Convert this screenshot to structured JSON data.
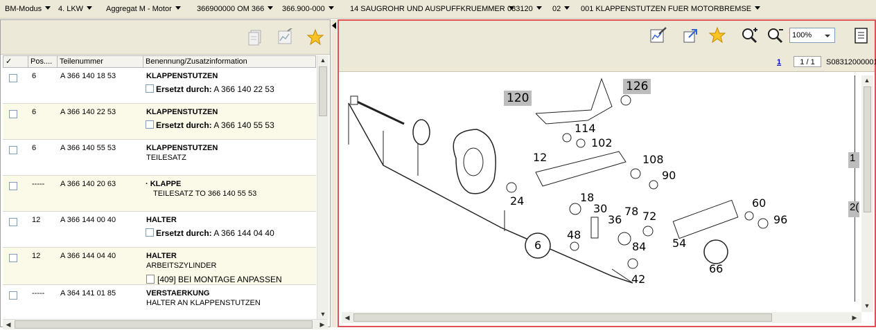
{
  "breadcrumbs": [
    {
      "label": "BM-Modus"
    },
    {
      "label": "4. LKW"
    },
    {
      "label": "Aggregat M  - Motor"
    },
    {
      "label": "366900000 OM 366"
    },
    {
      "label": "366.900-000"
    },
    {
      "label": "14 SAUGROHR UND AUSPUFFKRUEMMER"
    },
    {
      "label": "083120"
    },
    {
      "label": "02"
    },
    {
      "label": "001 KLAPPENSTUTZEN FUER MOTORBREMSE"
    }
  ],
  "left_toolbar": {
    "icons": [
      "add-to-list-icon",
      "edit-list-icon",
      "favorite-star-icon"
    ]
  },
  "table": {
    "headers": {
      "check": "✓",
      "pos": "Pos....",
      "partno": "Teilenummer",
      "desc": "Benennung/Zusatzinformation"
    },
    "rows": [
      {
        "pos": "6",
        "partno": "A 366 140 18 53",
        "name": "KLAPPENSTUTZEN",
        "replaced_label": "Ersetzt durch:",
        "replaced_by": "A 366 140 22 53"
      },
      {
        "pos": "6",
        "partno": "A 366 140 22 53",
        "name": "KLAPPENSTUTZEN",
        "replaced_label": "Ersetzt durch:",
        "replaced_by": "A 366 140 55 53"
      },
      {
        "pos": "6",
        "partno": "A 366 140 55 53",
        "name": "KLAPPENSTUTZEN",
        "sub": "TEILESATZ"
      },
      {
        "pos": "-----",
        "partno": "A 366 140 20 63",
        "name": "· KLAPPE",
        "sub": "TEILESATZ TO 366 140 55 53"
      },
      {
        "pos": "12",
        "partno": "A 366 144 00 40",
        "name": "HALTER",
        "replaced_label": "Ersetzt durch:",
        "replaced_by": "A 366 144 04 40"
      },
      {
        "pos": "12",
        "partno": "A 366 144 04 40",
        "name": "HALTER",
        "sub": "ARBEITSZYLINDER",
        "note": "[409] BEI MONTAGE ANPASSEN"
      },
      {
        "pos": "-----",
        "partno": "A 364 141 01 85",
        "name": "VERSTAERKUNG",
        "sub": "HALTER AN KLAPPENSTUTZEN"
      }
    ]
  },
  "right_toolbar": {
    "icons": [
      "edit-drawing-icon",
      "open-external-icon",
      "favorite-star-icon",
      "zoom-in-icon",
      "zoom-out-icon",
      "document-icon"
    ],
    "zoom": "100%"
  },
  "pager": {
    "page_link": "1",
    "page_count": "1 / 1",
    "image_id": "S08312000001"
  },
  "drawing": {
    "callouts_highlighted": [
      "120",
      "126"
    ],
    "labels": [
      "114",
      "102",
      "12",
      "108",
      "90",
      "24",
      "18",
      "30",
      "78",
      "72",
      "36",
      "60",
      "96",
      "6",
      "48",
      "84",
      "54",
      "66",
      "42"
    ],
    "edge_labels": [
      "1",
      "2("
    ]
  },
  "colors": {
    "toolbar_bg": "#ece9d8",
    "alt_row": "#fbfae8",
    "pane_border_active": "#e05050",
    "callout_bg": "#bdbdbd",
    "link": "#0000cc"
  }
}
